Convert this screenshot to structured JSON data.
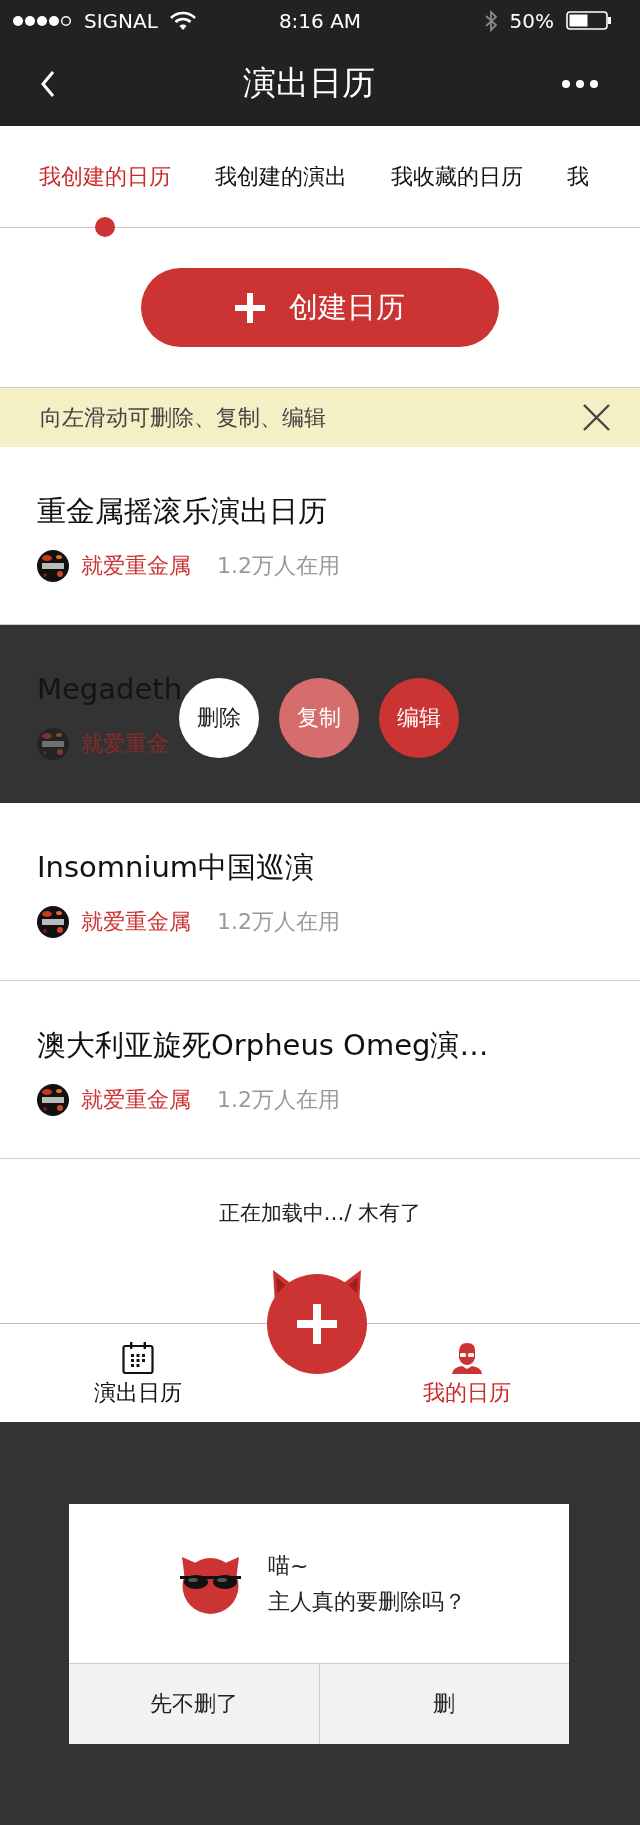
{
  "status_bar": {
    "carrier": "SIGNAL",
    "time": "8:16 AM",
    "battery": "50%"
  },
  "nav_bar": {
    "title": "演出日历"
  },
  "tabs": [
    {
      "label": "我创建的日历",
      "selected": true
    },
    {
      "label": "我创建的演出",
      "selected": false
    },
    {
      "label": "我收藏的日历",
      "selected": false
    },
    {
      "label": "我",
      "selected": false
    }
  ],
  "create_button": {
    "label": "创建日历"
  },
  "tip_bar": {
    "text": "向左滑动可删除、复制、编辑"
  },
  "calendars": [
    {
      "title": "重金属摇滚乐演出日历",
      "author": "就爱重金属",
      "users": "1.2万人在用",
      "swiped": false
    },
    {
      "title": "Megadeth",
      "author": "就爱重金",
      "swiped": true,
      "actions": [
        {
          "label": "删除",
          "kind": "delete"
        },
        {
          "label": "复制",
          "kind": "copy"
        },
        {
          "label": "编辑",
          "kind": "edit"
        }
      ]
    },
    {
      "title": "Insomnium中国巡演",
      "author": "就爱重金属",
      "users": "1.2万人在用",
      "swiped": false
    },
    {
      "title": "澳大利亚旋死Orpheus Omeg演…",
      "author": "就爱重金属",
      "users": "1.2万人在用",
      "swiped": false
    }
  ],
  "load_status": "正在加载中…/ 木有了",
  "bottom_tabs": [
    {
      "label": "演出日历",
      "kind": "calendar",
      "selected": false
    },
    {
      "label": "我的日历",
      "kind": "profile",
      "selected": true
    }
  ],
  "dialog": {
    "title": "喵~",
    "message": "主人真的要删除吗？",
    "buttons": [
      {
        "label": "先不删了"
      },
      {
        "label": "删"
      }
    ]
  }
}
